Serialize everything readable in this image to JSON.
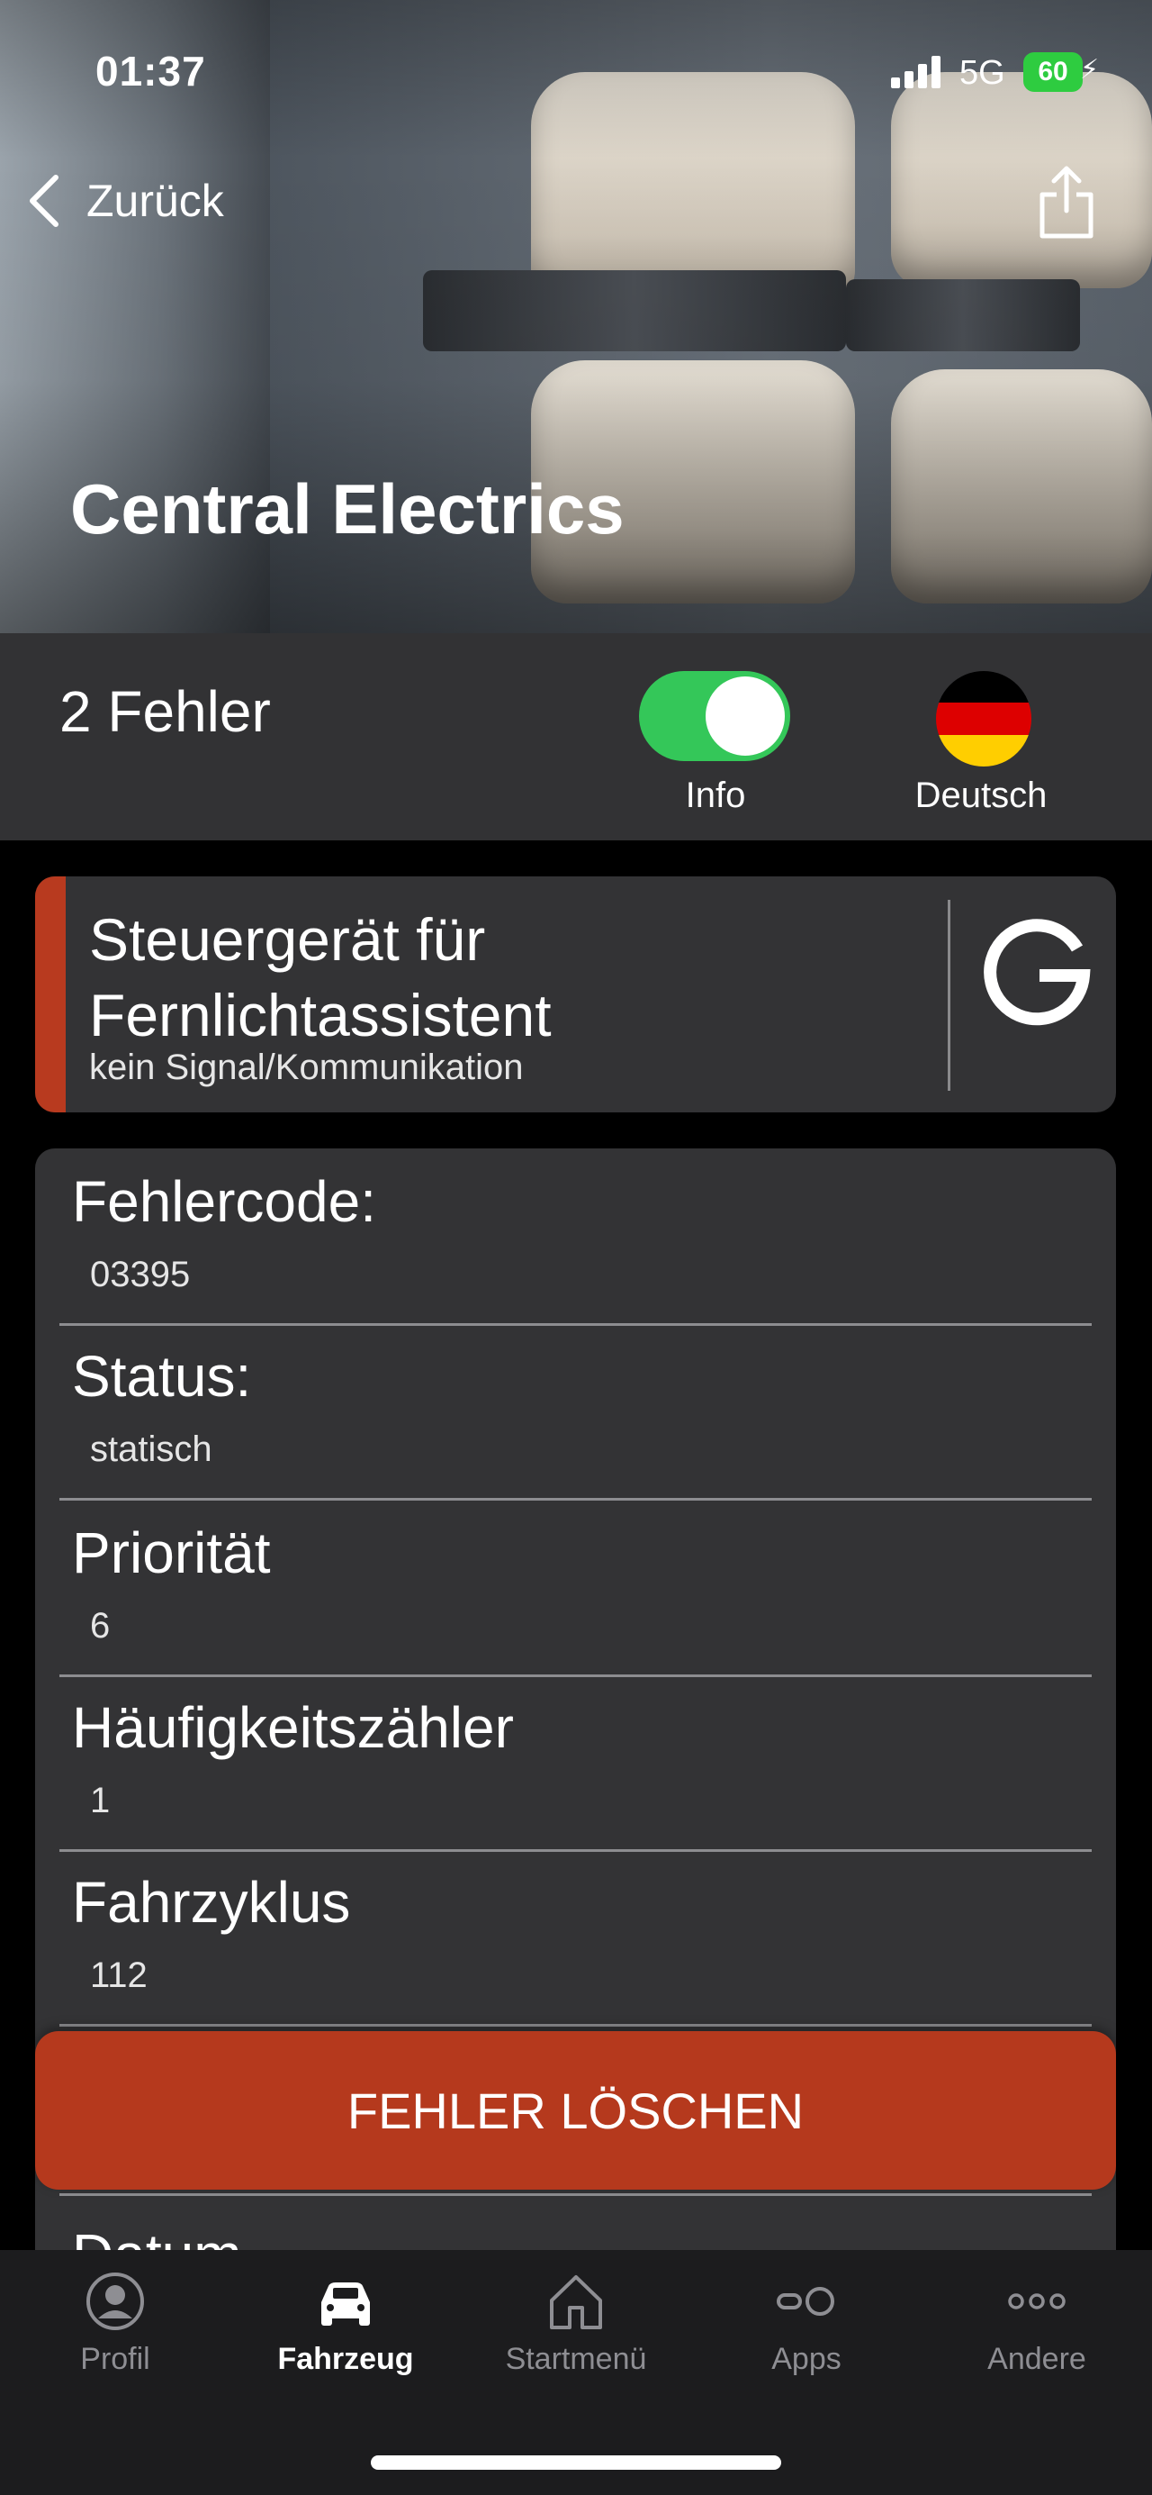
{
  "status_bar": {
    "time": "01:37",
    "network": "5G",
    "battery": "60"
  },
  "nav": {
    "back_label": "Zurück"
  },
  "header": {
    "title": "Central Electrics"
  },
  "summary": {
    "error_count": "2 Fehler",
    "info_label": "Info",
    "info_enabled": true,
    "language_label": "Deutsch"
  },
  "fault": {
    "name": "Steuergerät für Fernlichtassistent",
    "description": "kein Signal/Kommunikation",
    "accent_color": "#b83a1f"
  },
  "details": {
    "rows": [
      {
        "label": "Fehlercode:",
        "value": "03395"
      },
      {
        "label": "Status:",
        "value": "statisch"
      },
      {
        "label": "Priorität",
        "value": "6"
      },
      {
        "label": "Häufigkeitszähler",
        "value": "1"
      },
      {
        "label": "Fahrzyklus",
        "value": "112"
      },
      {
        "label": "Datum",
        "value": ""
      }
    ]
  },
  "actions": {
    "delete_label": "FEHLER LÖSCHEN",
    "delete_color": "#b5391d"
  },
  "tabs": [
    {
      "label": "Profil",
      "icon": "profile-icon",
      "active": false
    },
    {
      "label": "Fahrzeug",
      "icon": "car-icon",
      "active": true
    },
    {
      "label": "Startmenü",
      "icon": "home-icon",
      "active": false
    },
    {
      "label": "Apps",
      "icon": "apps-icon",
      "active": false
    },
    {
      "label": "Andere",
      "icon": "more-icon",
      "active": false
    }
  ],
  "colors": {
    "toggle_on": "#34c759",
    "card_bg": "#333335",
    "summary_bg": "#323234"
  }
}
